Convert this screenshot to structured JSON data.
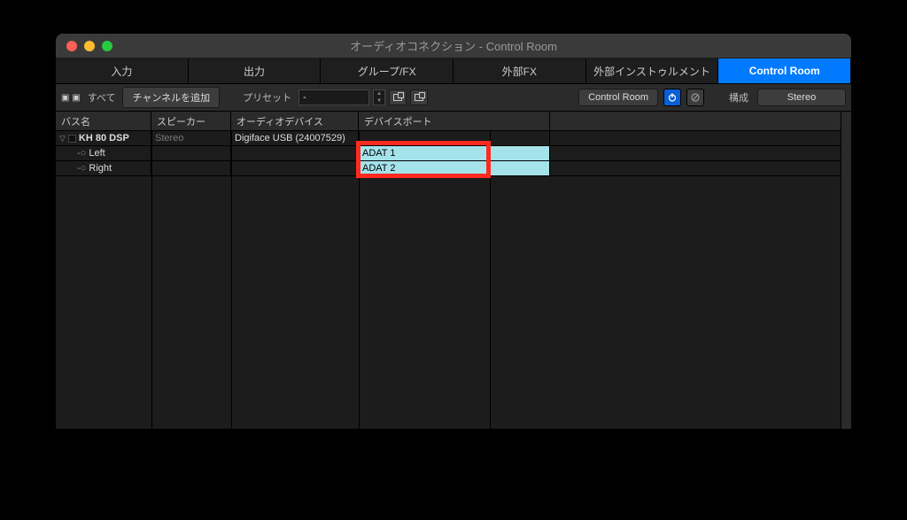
{
  "window": {
    "title": "オーディオコネクション - Control Room"
  },
  "tabs": {
    "input": "入力",
    "output": "出力",
    "groupfx": "グループ/FX",
    "externalfx": "外部FX",
    "externalinst": "外部インストゥルメント",
    "controlroom": "Control Room"
  },
  "toolbar": {
    "all_label": "すべて",
    "add_channel": "チャンネルを追加",
    "preset_label": "プリセット",
    "preset_value": "-",
    "cr_label": "Control Room",
    "kosei_label": "構成",
    "stereo_label": "Stereo"
  },
  "columns": {
    "bus": "バス名",
    "speaker": "スピーカー",
    "device": "オーディオデバイス",
    "port": "デバイスポート"
  },
  "rows": {
    "parent": {
      "name": "KH 80 DSP",
      "speaker": "Stereo",
      "device": "Digiface USB (24007529)"
    },
    "left": {
      "name": "Left",
      "port": "ADAT 1"
    },
    "right": {
      "name": "Right",
      "port": "ADAT 2"
    }
  }
}
